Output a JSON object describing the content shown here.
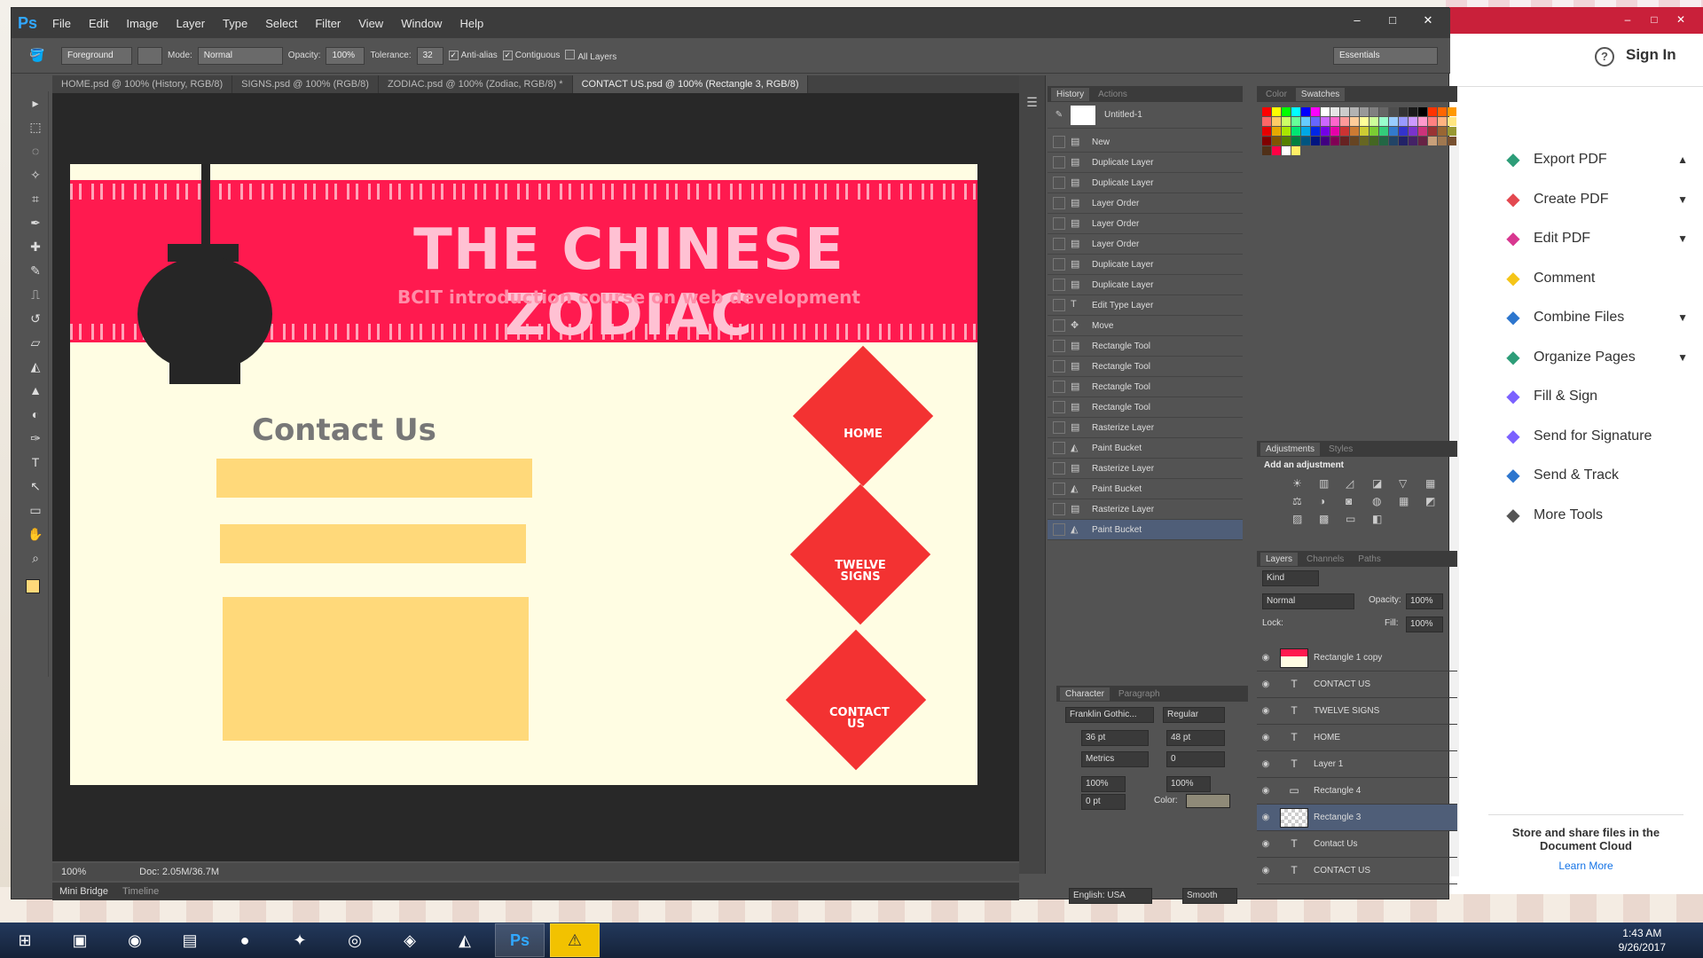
{
  "photoshop": {
    "logo": "Ps",
    "menu": [
      "File",
      "Edit",
      "Image",
      "Layer",
      "Type",
      "Select",
      "Filter",
      "View",
      "Window",
      "Help"
    ],
    "window_controls": [
      "–",
      "□",
      "✕"
    ],
    "options": {
      "fill_source": "Foreground",
      "mode_label": "Mode:",
      "mode_value": "Normal",
      "opacity_label": "Opacity:",
      "opacity_value": "100%",
      "tolerance_label": "Tolerance:",
      "tolerance_value": "32",
      "anti_alias": "Anti-alias",
      "contiguous": "Contiguous",
      "all_layers": "All Layers",
      "workspace": "Essentials"
    },
    "tabs": [
      {
        "label": "HOME.psd @ 100% (History, RGB/8)"
      },
      {
        "label": "SIGNS.psd @ 100% (RGB/8)"
      },
      {
        "label": "ZODIAC.psd @ 100% (Zodiac, RGB/8) *"
      },
      {
        "label": "CONTACT US.psd @ 100% (Rectangle 3, RGB/8)"
      }
    ],
    "status": {
      "zoom": "100%",
      "doc": "Doc: 2.05M/36.7M"
    },
    "bottom_tabs": [
      "Mini Bridge",
      "Timeline"
    ]
  },
  "document": {
    "title": "THE CHINESE ZODIAC",
    "subtitle": "BCIT introduction course on web development",
    "contact_heading": "Contact Us",
    "nav": [
      "HOME",
      "TWELVE SIGNS",
      "CONTACT US"
    ]
  },
  "history": {
    "tabs": [
      "History",
      "Actions"
    ],
    "snapshot": "Untitled-1",
    "items": [
      {
        "label": "New",
        "icon": "doc"
      },
      {
        "label": "Duplicate Layer",
        "icon": "doc"
      },
      {
        "label": "Duplicate Layer",
        "icon": "doc"
      },
      {
        "label": "Layer Order",
        "icon": "doc"
      },
      {
        "label": "Layer Order",
        "icon": "doc"
      },
      {
        "label": "Layer Order",
        "icon": "doc"
      },
      {
        "label": "Duplicate Layer",
        "icon": "doc"
      },
      {
        "label": "Duplicate Layer",
        "icon": "doc"
      },
      {
        "label": "Edit Type Layer",
        "icon": "T"
      },
      {
        "label": "Move",
        "icon": "move"
      },
      {
        "label": "Rectangle Tool",
        "icon": "doc"
      },
      {
        "label": "Rectangle Tool",
        "icon": "doc"
      },
      {
        "label": "Rectangle Tool",
        "icon": "doc"
      },
      {
        "label": "Rectangle Tool",
        "icon": "doc"
      },
      {
        "label": "Rasterize Layer",
        "icon": "doc"
      },
      {
        "label": "Paint Bucket",
        "icon": "bucket"
      },
      {
        "label": "Rasterize Layer",
        "icon": "doc"
      },
      {
        "label": "Paint Bucket",
        "icon": "bucket"
      },
      {
        "label": "Rasterize Layer",
        "icon": "doc"
      },
      {
        "label": "Paint Bucket",
        "icon": "bucket"
      }
    ]
  },
  "swatches": {
    "tabs": [
      "Color",
      "Swatches"
    ]
  },
  "adjustments": {
    "tabs": [
      "Adjustments",
      "Styles"
    ],
    "heading": "Add an adjustment"
  },
  "layers": {
    "tabs": [
      "Layers",
      "Channels",
      "Paths"
    ],
    "kind": "Kind",
    "blend": "Normal",
    "opacity_label": "Opacity:",
    "opacity": "100%",
    "lock_label": "Lock:",
    "fill_label": "Fill:",
    "fill": "100%",
    "items": [
      {
        "name": "Rectangle 1 copy",
        "type": "img"
      },
      {
        "name": "CONTACT US",
        "type": "T"
      },
      {
        "name": "TWELVE SIGNS",
        "type": "T"
      },
      {
        "name": "HOME",
        "type": "T"
      },
      {
        "name": "Layer 1",
        "type": "T"
      },
      {
        "name": "Rectangle 4",
        "type": "rect"
      },
      {
        "name": "Rectangle 3",
        "type": "img"
      },
      {
        "name": "Contact Us",
        "type": "T"
      },
      {
        "name": "CONTACT US",
        "type": "T"
      }
    ]
  },
  "character": {
    "tabs": [
      "Character",
      "Paragraph"
    ],
    "font": "Franklin Gothic...",
    "style": "Regular",
    "size": "36 pt",
    "leading": "48 pt",
    "kerning": "Metrics",
    "tracking": "0",
    "vscale": "100%",
    "hscale": "100%",
    "baseline": "0 pt",
    "color_label": "Color:",
    "language": "English: USA",
    "aa": "Smooth"
  },
  "acrobat": {
    "sign_in": "Sign In",
    "tools": [
      {
        "label": "Export PDF",
        "icon": "export-pdf",
        "chevron": "up",
        "color": "#2d9d78"
      },
      {
        "label": "Create PDF",
        "icon": "create-pdf",
        "chevron": "down",
        "color": "#e34850"
      },
      {
        "label": "Edit PDF",
        "icon": "edit-pdf",
        "chevron": "down",
        "color": "#d83790"
      },
      {
        "label": "Comment",
        "icon": "comment",
        "chevron": "",
        "color": "#f5c518"
      },
      {
        "label": "Combine Files",
        "icon": "combine",
        "chevron": "down",
        "color": "#2d76ce"
      },
      {
        "label": "Organize Pages",
        "icon": "organize",
        "chevron": "down",
        "color": "#2d9d78"
      },
      {
        "label": "Fill & Sign",
        "icon": "fill-sign",
        "chevron": "",
        "color": "#7b61ff"
      },
      {
        "label": "Send for Signature",
        "icon": "signature",
        "chevron": "",
        "color": "#7b61ff"
      },
      {
        "label": "Send & Track",
        "icon": "send-track",
        "chevron": "",
        "color": "#2d76ce"
      },
      {
        "label": "More Tools",
        "icon": "more-tools",
        "chevron": "",
        "color": "#555"
      }
    ],
    "promo": "Store and share files in the Document Cloud",
    "learn_more": "Learn More"
  },
  "taskbar": {
    "apps": [
      "start",
      "explorer",
      "chrome",
      "files",
      "spotify",
      "tips",
      "camera",
      "line",
      "acrobat",
      "photoshop",
      "warning"
    ],
    "time": "1:43 AM",
    "date": "9/26/2017"
  }
}
